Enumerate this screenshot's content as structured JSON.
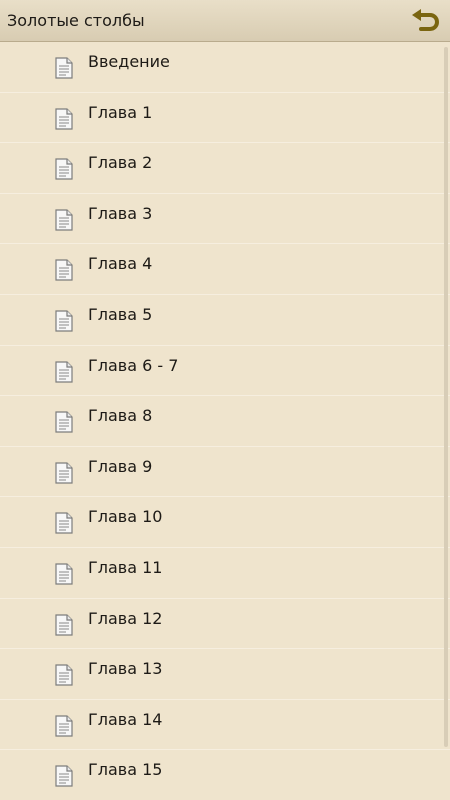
{
  "header": {
    "title": "Золотые столбы"
  },
  "icons": {
    "back": "back-arrow-icon",
    "item": "document-icon"
  },
  "colors": {
    "background": "#efe4cd",
    "header": "#ddd2ba",
    "back_icon": "#7a6510"
  },
  "list": {
    "items": [
      {
        "label": "Введение"
      },
      {
        "label": "Глава 1"
      },
      {
        "label": "Глава 2"
      },
      {
        "label": "Глава 3"
      },
      {
        "label": "Глава 4"
      },
      {
        "label": "Глава 5"
      },
      {
        "label": "Глава 6 - 7"
      },
      {
        "label": "Глава 8"
      },
      {
        "label": "Глава 9"
      },
      {
        "label": "Глава 10"
      },
      {
        "label": "Глава 11"
      },
      {
        "label": "Глава 12"
      },
      {
        "label": "Глава 13"
      },
      {
        "label": "Глава 14"
      },
      {
        "label": "Глава 15"
      }
    ]
  }
}
